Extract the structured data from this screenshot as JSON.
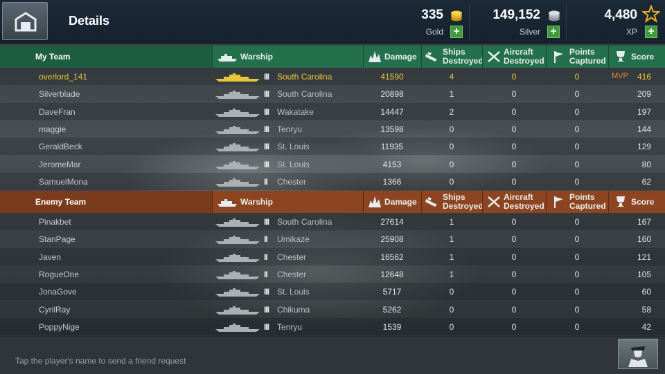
{
  "header": {
    "title": "Details",
    "gold": {
      "value": "335",
      "label": "Gold"
    },
    "silver": {
      "value": "149,152",
      "label": "Silver"
    },
    "xp": {
      "value": "4,480",
      "label": "XP"
    }
  },
  "columns": {
    "warship": "Warship",
    "damage": "Damage",
    "ships_destroyed": [
      "Ships",
      "Destroyed"
    ],
    "aircraft_destroyed": [
      "Aircraft",
      "Destroyed"
    ],
    "points_captured": [
      "Points",
      "Captured"
    ],
    "score": "Score"
  },
  "my_team": {
    "label": "My Team",
    "players": [
      {
        "name": "overlord_141",
        "tier": "III",
        "ship": "South Carolina",
        "damage": "41590",
        "ships": "4",
        "aircraft": "0",
        "points": "0",
        "mvp": "MVP",
        "score": "416"
      },
      {
        "name": "Silverblade",
        "tier": "III",
        "ship": "South Carolina",
        "damage": "20898",
        "ships": "1",
        "aircraft": "0",
        "points": "0",
        "mvp": "",
        "score": "209"
      },
      {
        "name": "DaveFran",
        "tier": "III",
        "ship": "Wakatake",
        "damage": "14447",
        "ships": "2",
        "aircraft": "0",
        "points": "0",
        "mvp": "",
        "score": "197"
      },
      {
        "name": "maggie",
        "tier": "III",
        "ship": "Tenryu",
        "damage": "13598",
        "ships": "0",
        "aircraft": "0",
        "points": "0",
        "mvp": "",
        "score": "144"
      },
      {
        "name": "GeraldBeck",
        "tier": "III",
        "ship": "St. Louis",
        "damage": "11935",
        "ships": "0",
        "aircraft": "0",
        "points": "0",
        "mvp": "",
        "score": "129"
      },
      {
        "name": "JeromeMar",
        "tier": "III",
        "ship": "St. Louis",
        "damage": "4153",
        "ships": "0",
        "aircraft": "0",
        "points": "0",
        "mvp": "",
        "score": "80"
      },
      {
        "name": "SamuelMona",
        "tier": "II",
        "ship": "Chester",
        "damage": "1366",
        "ships": "0",
        "aircraft": "0",
        "points": "0",
        "mvp": "",
        "score": "62"
      }
    ]
  },
  "enemy_team": {
    "label": "Enemy Team",
    "players": [
      {
        "name": "Pinakbet",
        "tier": "III",
        "ship": "South Carolina",
        "damage": "27614",
        "ships": "1",
        "aircraft": "0",
        "points": "0",
        "score": "167"
      },
      {
        "name": "StanPage",
        "tier": "II",
        "ship": "Umikaze",
        "damage": "25908",
        "ships": "1",
        "aircraft": "0",
        "points": "0",
        "score": "160"
      },
      {
        "name": "Javen",
        "tier": "II",
        "ship": "Chester",
        "damage": "16562",
        "ships": "1",
        "aircraft": "0",
        "points": "0",
        "score": "121"
      },
      {
        "name": "RogueOne",
        "tier": "II",
        "ship": "Chester",
        "damage": "12648",
        "ships": "1",
        "aircraft": "0",
        "points": "0",
        "score": "105"
      },
      {
        "name": "JonaGove",
        "tier": "III",
        "ship": "St. Louis",
        "damage": "5717",
        "ships": "0",
        "aircraft": "0",
        "points": "0",
        "score": "60"
      },
      {
        "name": "CyrilRay",
        "tier": "III",
        "ship": "Chikuma",
        "damage": "5262",
        "ships": "0",
        "aircraft": "0",
        "points": "0",
        "score": "58"
      },
      {
        "name": "PoppyNige",
        "tier": "III",
        "ship": "Tenryu",
        "damage": "1539",
        "ships": "0",
        "aircraft": "0",
        "points": "0",
        "score": "42"
      }
    ]
  },
  "footer": {
    "hint": "Tap the player's name to send a friend request"
  },
  "colors": {
    "my_team": "#1e5e40",
    "enemy_team": "#7a3a1c",
    "highlight": "#e9c53a",
    "mvp": "#e88a2a",
    "plus": "#3f9a3a"
  },
  "icons": [
    "port-icon",
    "gold-coins-icon",
    "silver-coins-icon",
    "star-icon",
    "plus-icon",
    "warship-icon",
    "explosion-icon",
    "sinking-ship-icon",
    "crossed-plane-icon",
    "flag-icon",
    "trophy-icon",
    "captain-icon"
  ]
}
